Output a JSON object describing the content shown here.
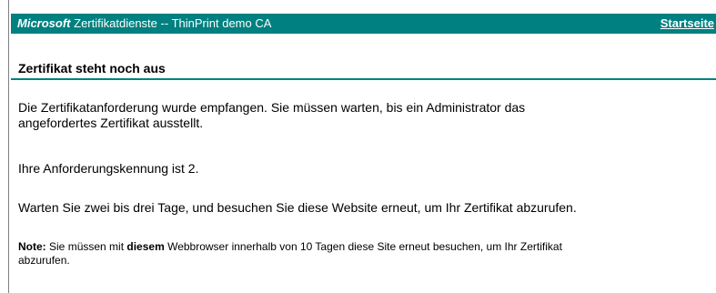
{
  "header": {
    "brand": "Microsoft",
    "service": "Zertifikatdienste",
    "separator": "--",
    "ca_name": "ThinPrint demo CA",
    "home_link": "Startseite"
  },
  "main": {
    "title": "Zertifikat steht noch aus",
    "paragraph_received_line1": "Die Zertifikatanforderung wurde empfangen. Sie müssen warten, bis ein Administrator das",
    "paragraph_received_line2": "angefordertes Zertifikat ausstellt.",
    "paragraph_request_id": "Ihre Anforderungskennung ist 2.",
    "paragraph_wait": "Warten Sie zwei bis drei Tage, und besuchen Sie diese Website erneut, um Ihr Zertifikat abzurufen.",
    "note": {
      "label": "Note:",
      "text_before": "Sie müssen mit",
      "emphasis": "diesem",
      "text_after_line1": "Webbrowser innerhalb von 10 Tagen diese Site erneut besuchen, um Ihr Zertifikat",
      "text_after_line2": "abzurufen."
    }
  },
  "colors": {
    "header_background": "#008080",
    "header_text": "#ffffff",
    "rule": "#008080"
  }
}
